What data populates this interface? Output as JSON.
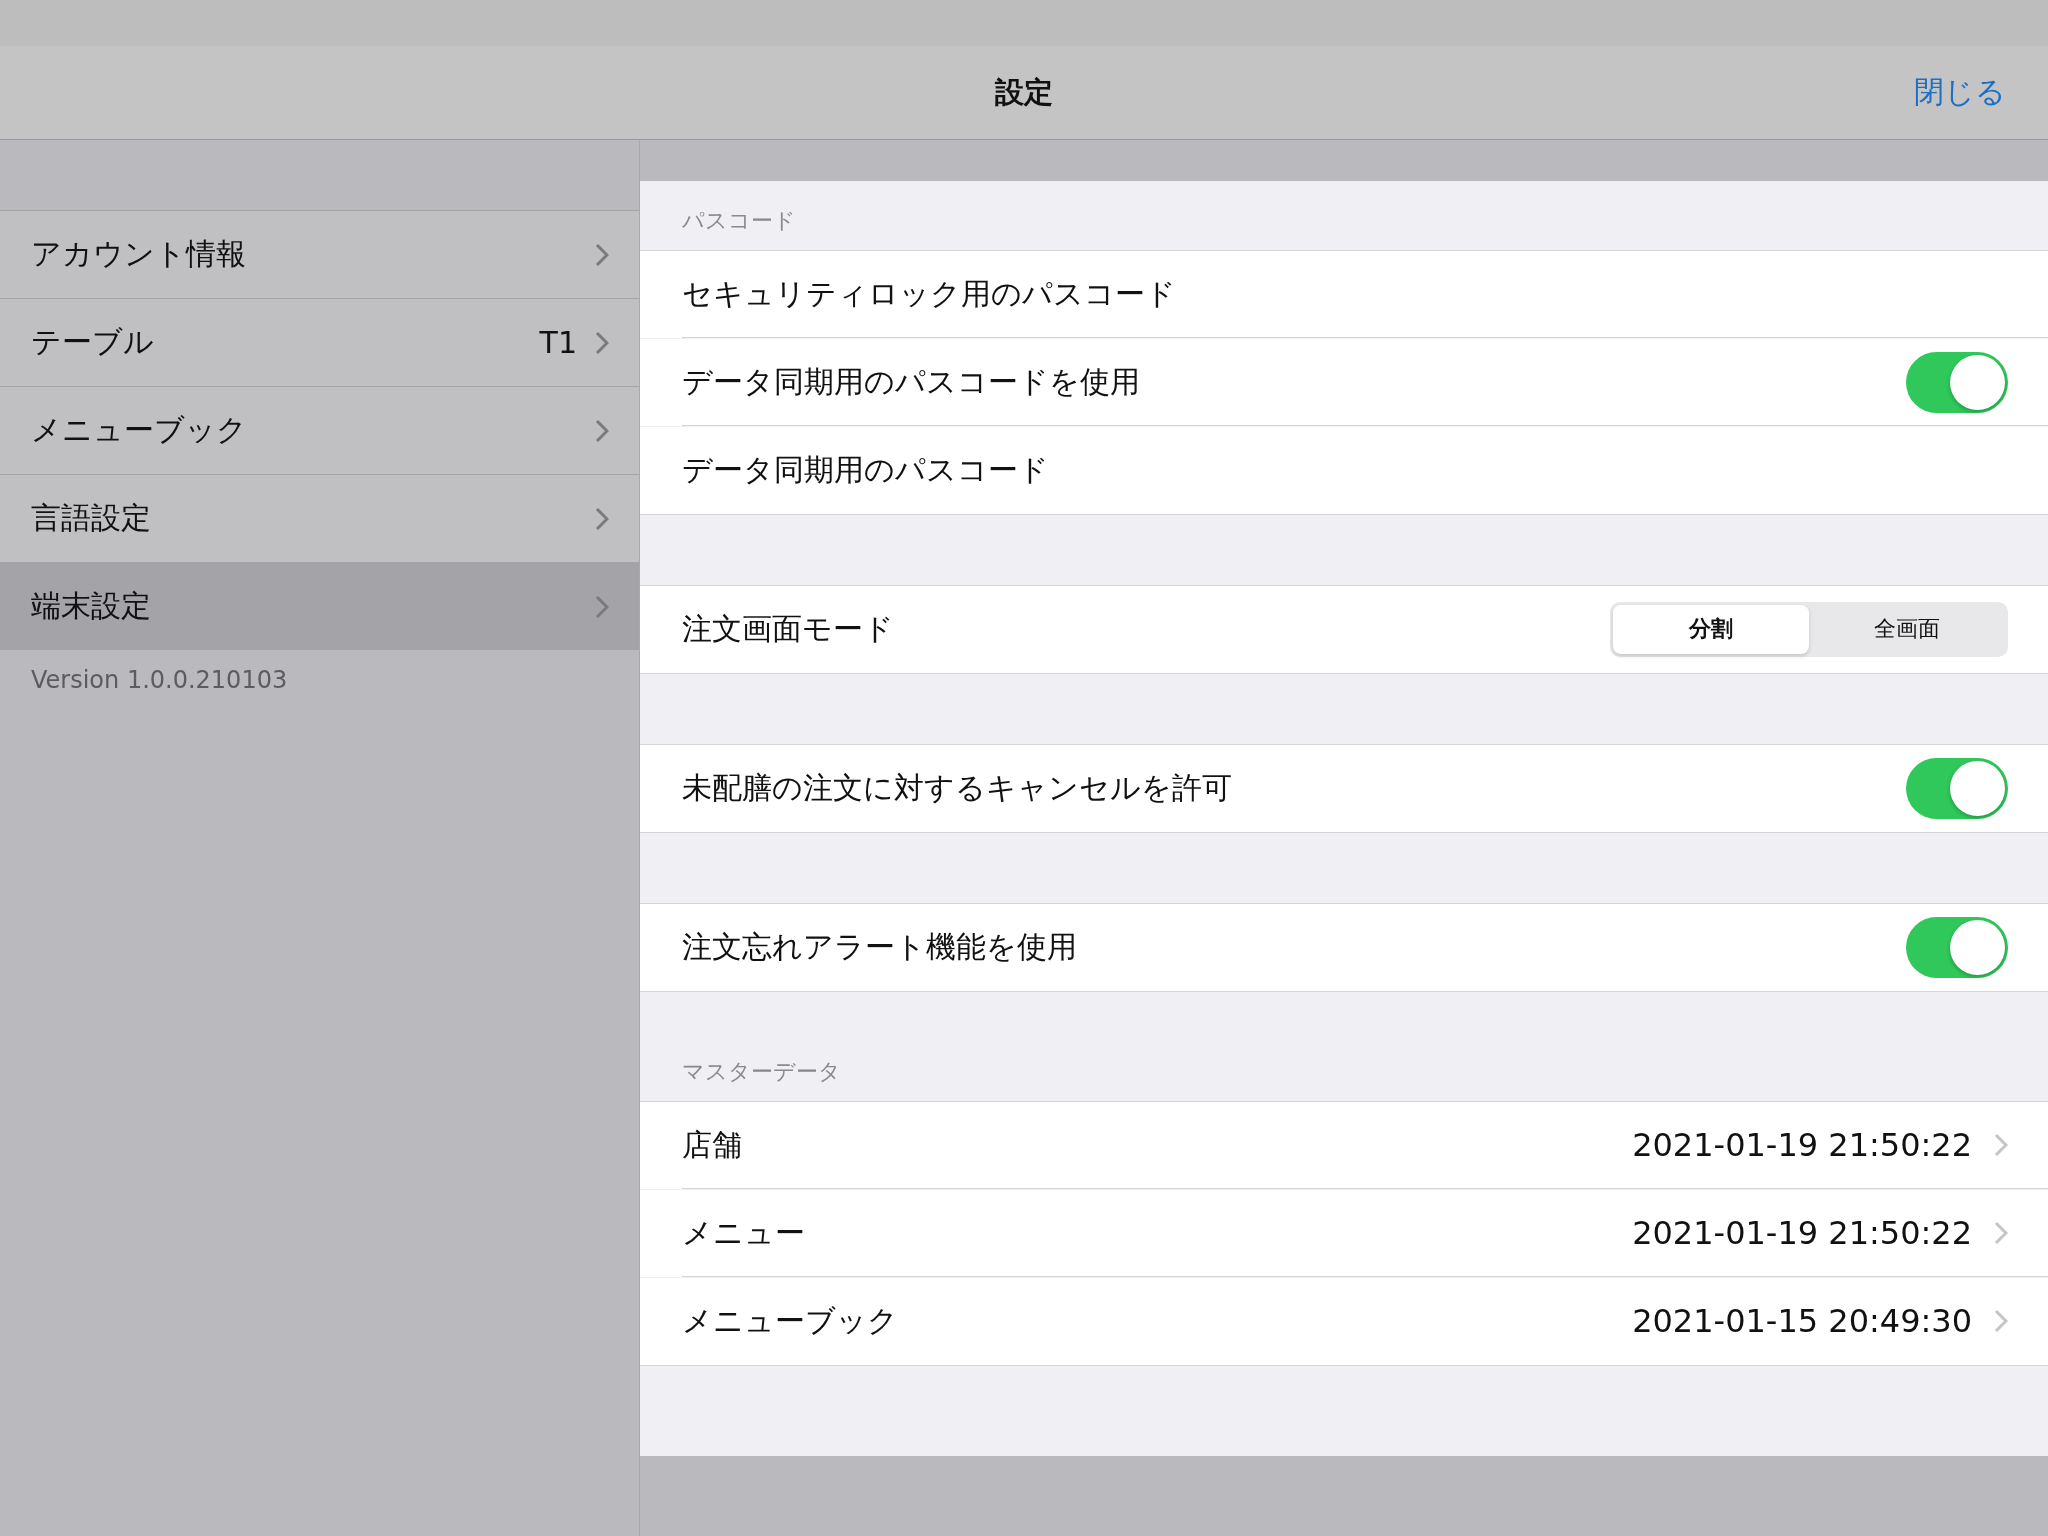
{
  "nav": {
    "title": "設定",
    "close": "閉じる"
  },
  "sidebar": {
    "items": [
      {
        "label": "アカウント情報",
        "selected": false
      },
      {
        "label": "テーブル",
        "value": "T1",
        "selected": false
      },
      {
        "label": "メニューブック",
        "selected": false
      },
      {
        "label": "言語設定",
        "selected": false
      },
      {
        "label": "端末設定",
        "selected": true
      }
    ],
    "version": "Version 1.0.0.210103"
  },
  "sections": [
    {
      "header": "パスコード",
      "rows": [
        {
          "kind": "plain",
          "label": "セキュリティロック用のパスコード"
        },
        {
          "kind": "toggle",
          "label": "データ同期用のパスコードを使用",
          "on": true
        },
        {
          "kind": "plain",
          "label": "データ同期用のパスコード"
        }
      ]
    },
    {
      "rows": [
        {
          "kind": "segmented",
          "label": "注文画面モード",
          "options": [
            {
              "label": "分割",
              "selected": true
            },
            {
              "label": "全画面",
              "selected": false
            }
          ]
        }
      ]
    },
    {
      "rows": [
        {
          "kind": "toggle",
          "label": "未配膳の注文に対するキャンセルを許可",
          "on": true
        }
      ]
    },
    {
      "rows": [
        {
          "kind": "toggle",
          "label": "注文忘れアラート機能を使用",
          "on": true
        }
      ]
    },
    {
      "header": "マスターデータ",
      "rows": [
        {
          "kind": "detail",
          "label": "店舗",
          "value": "2021-01-19 21:50:22"
        },
        {
          "kind": "detail",
          "label": "メニュー",
          "value": "2021-01-19 21:50:22"
        },
        {
          "kind": "detail",
          "label": "メニューブック",
          "value": "2021-01-15 20:49:30"
        }
      ]
    }
  ]
}
